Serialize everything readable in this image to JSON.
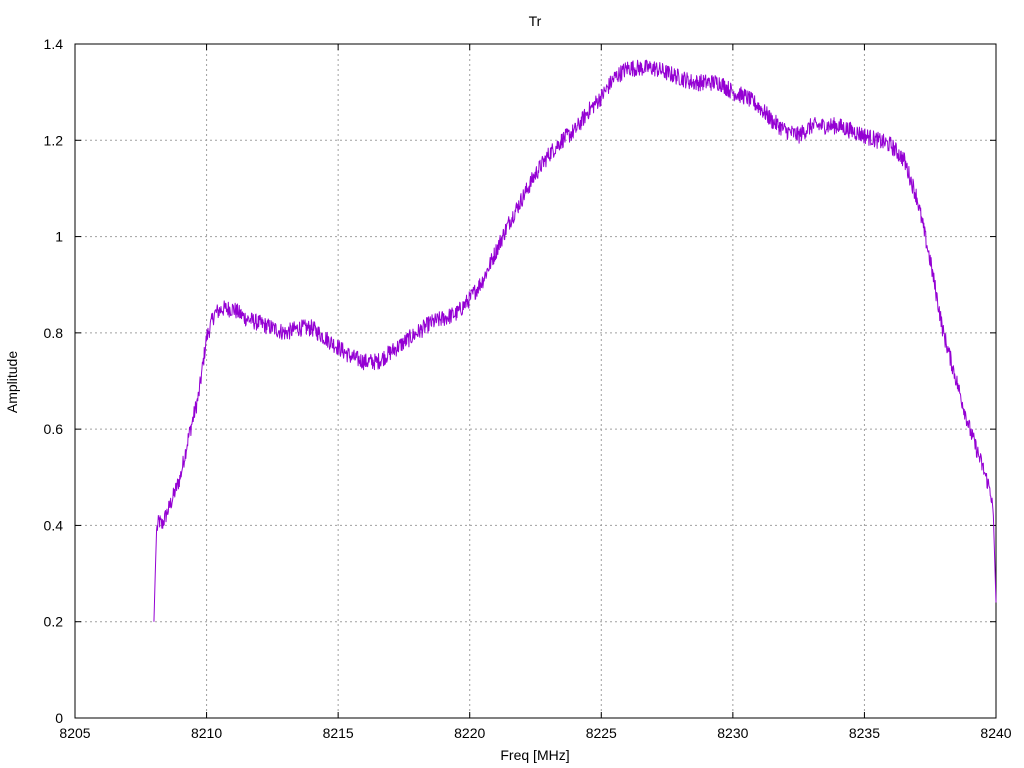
{
  "chart_data": {
    "type": "line",
    "title": "Tr",
    "xlabel": "Freq [MHz]",
    "ylabel": "Amplitude",
    "xlim": [
      8205,
      8240
    ],
    "ylim": [
      0,
      1.4
    ],
    "xticks": [
      "8205",
      "8210",
      "8215",
      "8220",
      "8225",
      "8230",
      "8235",
      "8240"
    ],
    "yticks": [
      "0",
      "0.2",
      "0.4",
      "0.6",
      "0.8",
      "1",
      "1.2",
      "1.4"
    ],
    "grid": true,
    "legend": "none",
    "series": [
      {
        "color": "#9400d3",
        "x": [
          8208.0,
          8208.05,
          8208.1,
          8208.2,
          8208.3,
          8208.6,
          8209.0,
          8209.3,
          8209.7,
          8210.0,
          8210.3,
          8210.6,
          8211.0,
          8211.5,
          8212.0,
          8212.5,
          8213.0,
          8213.5,
          8214.0,
          8214.5,
          8215.0,
          8215.5,
          8216.0,
          8216.5,
          8217.0,
          8217.5,
          8218.0,
          8218.5,
          8219.0,
          8219.5,
          8220.0,
          8220.5,
          8221.0,
          8221.5,
          8222.0,
          8222.5,
          8223.0,
          8223.5,
          8224.0,
          8224.5,
          8225.0,
          8225.5,
          8226.0,
          8226.5,
          8227.0,
          8227.5,
          8228.0,
          8228.5,
          8229.0,
          8229.5,
          8230.0,
          8230.5,
          8231.0,
          8231.5,
          8232.0,
          8232.5,
          8233.0,
          8233.5,
          8234.0,
          8234.5,
          8235.0,
          8235.5,
          8236.0,
          8236.5,
          8237.0,
          8237.5,
          8238.0,
          8238.5,
          8239.0,
          8239.5,
          8239.8,
          8239.9,
          8240.0
        ],
        "y": [
          0.2,
          0.3,
          0.39,
          0.41,
          0.4,
          0.44,
          0.5,
          0.58,
          0.67,
          0.79,
          0.84,
          0.85,
          0.85,
          0.83,
          0.82,
          0.81,
          0.8,
          0.81,
          0.81,
          0.79,
          0.77,
          0.75,
          0.74,
          0.74,
          0.76,
          0.78,
          0.8,
          0.82,
          0.83,
          0.84,
          0.87,
          0.91,
          0.97,
          1.03,
          1.08,
          1.13,
          1.17,
          1.2,
          1.22,
          1.26,
          1.29,
          1.33,
          1.35,
          1.35,
          1.35,
          1.34,
          1.33,
          1.32,
          1.32,
          1.32,
          1.3,
          1.29,
          1.27,
          1.24,
          1.22,
          1.21,
          1.23,
          1.23,
          1.23,
          1.22,
          1.21,
          1.2,
          1.19,
          1.16,
          1.08,
          0.95,
          0.8,
          0.7,
          0.6,
          0.52,
          0.47,
          0.42,
          0.24
        ]
      }
    ]
  }
}
